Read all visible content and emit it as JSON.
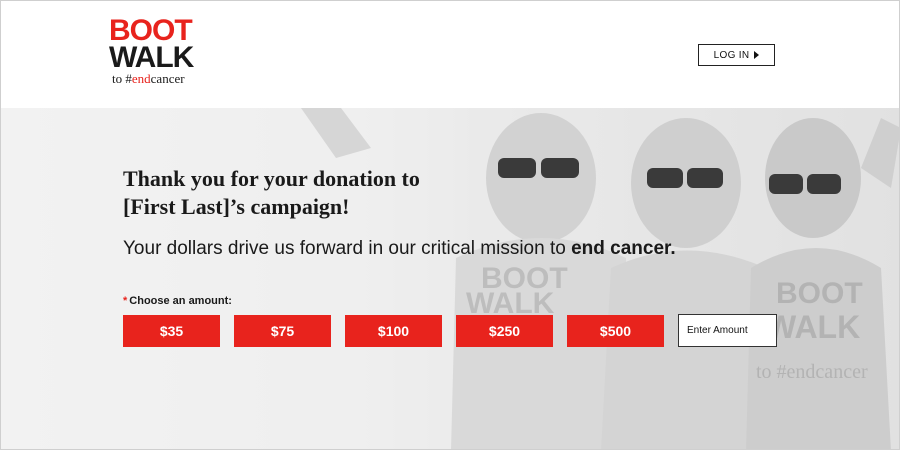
{
  "header": {
    "logo": {
      "line1": "BOOT",
      "line2": "WALK",
      "tag_prefix": "to #",
      "tag_highlight": "end",
      "tag_suffix": "cancer"
    },
    "login_label": "LOG IN"
  },
  "hero": {
    "headline_line1": "Thank you for your donation to",
    "headline_line2": "[First Last]’s campaign!",
    "subline_text": "Your dollars drive us forward in our critical mission to ",
    "subline_bold": "end cancer.",
    "photo_shirt_text": {
      "line1": "BOOT",
      "line2": "WALK",
      "line3": "to #endcancer"
    }
  },
  "donation": {
    "required_mark": "*",
    "label": "Choose an amount:",
    "amounts": [
      "$35",
      "$75",
      "$100",
      "$250",
      "$500"
    ],
    "custom_placeholder": "Enter Amount"
  },
  "colors": {
    "brand_red": "#e8231d",
    "text_dark": "#1a1a1a"
  },
  "icons": {
    "login_arrow": "play-arrow-icon"
  }
}
